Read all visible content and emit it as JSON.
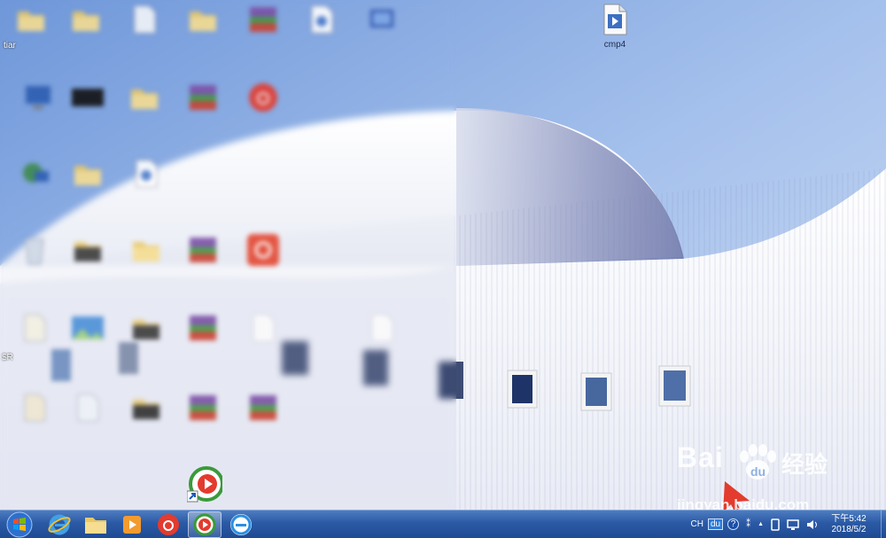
{
  "desktop": {
    "visible_icon": {
      "label": "cmp4",
      "icon": "media-file-icon"
    },
    "left_edge_labels": [
      "tiar",
      "$R"
    ],
    "blurred_icons": [
      {
        "icon": "folder-icon",
        "label": ""
      },
      {
        "icon": "folder-icon",
        "label": ""
      },
      {
        "icon": "file-icon",
        "label": ""
      },
      {
        "icon": "folder-icon",
        "label": ""
      },
      {
        "icon": "winrar-archive-icon",
        "label": ""
      },
      {
        "icon": "media-file-icon",
        "label": ""
      },
      {
        "icon": "shortcut-icon",
        "label": ""
      },
      {
        "icon": "computer-icon",
        "label": ""
      },
      {
        "icon": "black-file-icon",
        "label": ""
      },
      {
        "icon": "folder-icon",
        "label": ""
      },
      {
        "icon": "winrar-archive-icon",
        "label": ""
      },
      {
        "icon": "netease-music-icon",
        "label": ""
      },
      {
        "icon": "network-icon",
        "label": ""
      },
      {
        "icon": "folder-icon",
        "label": ""
      },
      {
        "icon": "media-file-icon",
        "label": ""
      },
      {
        "icon": "recycle-bin-icon",
        "label": ""
      },
      {
        "icon": "folder-icon",
        "label": ""
      },
      {
        "icon": "folder-icon",
        "label": ""
      },
      {
        "icon": "winrar-archive-icon",
        "label": ""
      },
      {
        "icon": "netease-music-icon",
        "label": ""
      },
      {
        "icon": "file-icon",
        "label": ""
      },
      {
        "icon": "image-file-icon",
        "label": ""
      },
      {
        "icon": "folder-icon",
        "label": ""
      },
      {
        "icon": "winrar-archive-icon",
        "label": ""
      },
      {
        "icon": "file-icon",
        "label": ""
      },
      {
        "icon": "file-icon",
        "label": ""
      },
      {
        "icon": "file-icon",
        "label": ""
      },
      {
        "icon": "folder-icon",
        "label": ""
      },
      {
        "icon": "winrar-archive-icon",
        "label": ""
      },
      {
        "icon": "winrar-archive-icon",
        "label": ""
      }
    ],
    "dragging_icon": {
      "icon": "tencent-video-icon"
    }
  },
  "taskbar": {
    "buttons": [
      {
        "name": "start-button",
        "icon": "windows-logo-icon"
      },
      {
        "name": "internet-explorer",
        "icon": "ie-icon"
      },
      {
        "name": "file-explorer",
        "icon": "folder-icon"
      },
      {
        "name": "media-player",
        "icon": "media-player-icon"
      },
      {
        "name": "netease-music",
        "icon": "netease-music-icon"
      },
      {
        "name": "tencent-video",
        "icon": "tencent-video-icon",
        "active": true
      },
      {
        "name": "browser",
        "icon": "e-browser-icon"
      }
    ],
    "tray": {
      "language": "CH",
      "ime": "du",
      "help": "?",
      "show_hidden": "▲",
      "clock_time": "下午5:42",
      "clock_date": "2018/5/2"
    }
  },
  "watermark": {
    "brand": "Bai",
    "brand_cn": "经验",
    "url": "jingyan.baidu.com"
  },
  "colors": {
    "sky": "#8fb0e0",
    "taskbar": "#2b5aa5",
    "accent_red": "#e33b2e"
  }
}
